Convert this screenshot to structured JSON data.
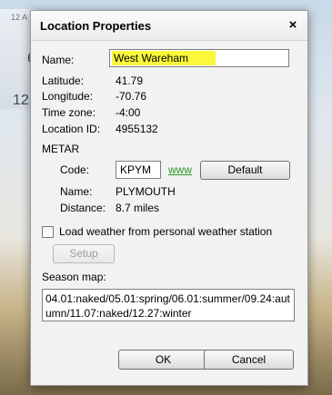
{
  "background": {
    "widget_top": "12 A",
    "widget_mid": "6",
    "widget_low": "12"
  },
  "dialog": {
    "title": "Location Properties",
    "close_glyph": "×"
  },
  "location": {
    "name_label": "Name:",
    "name_value": "West Wareham",
    "latitude_label": "Latitude:",
    "latitude_value": "41.79",
    "longitude_label": "Longitude:",
    "longitude_value": "-70.76",
    "timezone_label": "Time zone:",
    "timezone_value": "-4:00",
    "locationid_label": "Location ID:",
    "locationid_value": "4955132"
  },
  "metar": {
    "section_label": "METAR",
    "code_label": "Code:",
    "code_value": "KPYM",
    "www_link": "www",
    "default_button": "Default",
    "name_label": "Name:",
    "name_value": "PLYMOUTH",
    "distance_label": "Distance:",
    "distance_value": "8.7 miles"
  },
  "pws": {
    "checkbox_label": "Load weather from personal weather station",
    "checked": false,
    "setup_button": "Setup"
  },
  "season": {
    "label": "Season map:",
    "value": "04.01:naked/05.01:spring/06.01:summer/09.24:autumn/11.07:naked/12.27:winter"
  },
  "buttons": {
    "ok": "OK",
    "cancel": "Cancel"
  },
  "colors": {
    "highlight": "#fbf73a",
    "link": "#2a9a2a"
  }
}
